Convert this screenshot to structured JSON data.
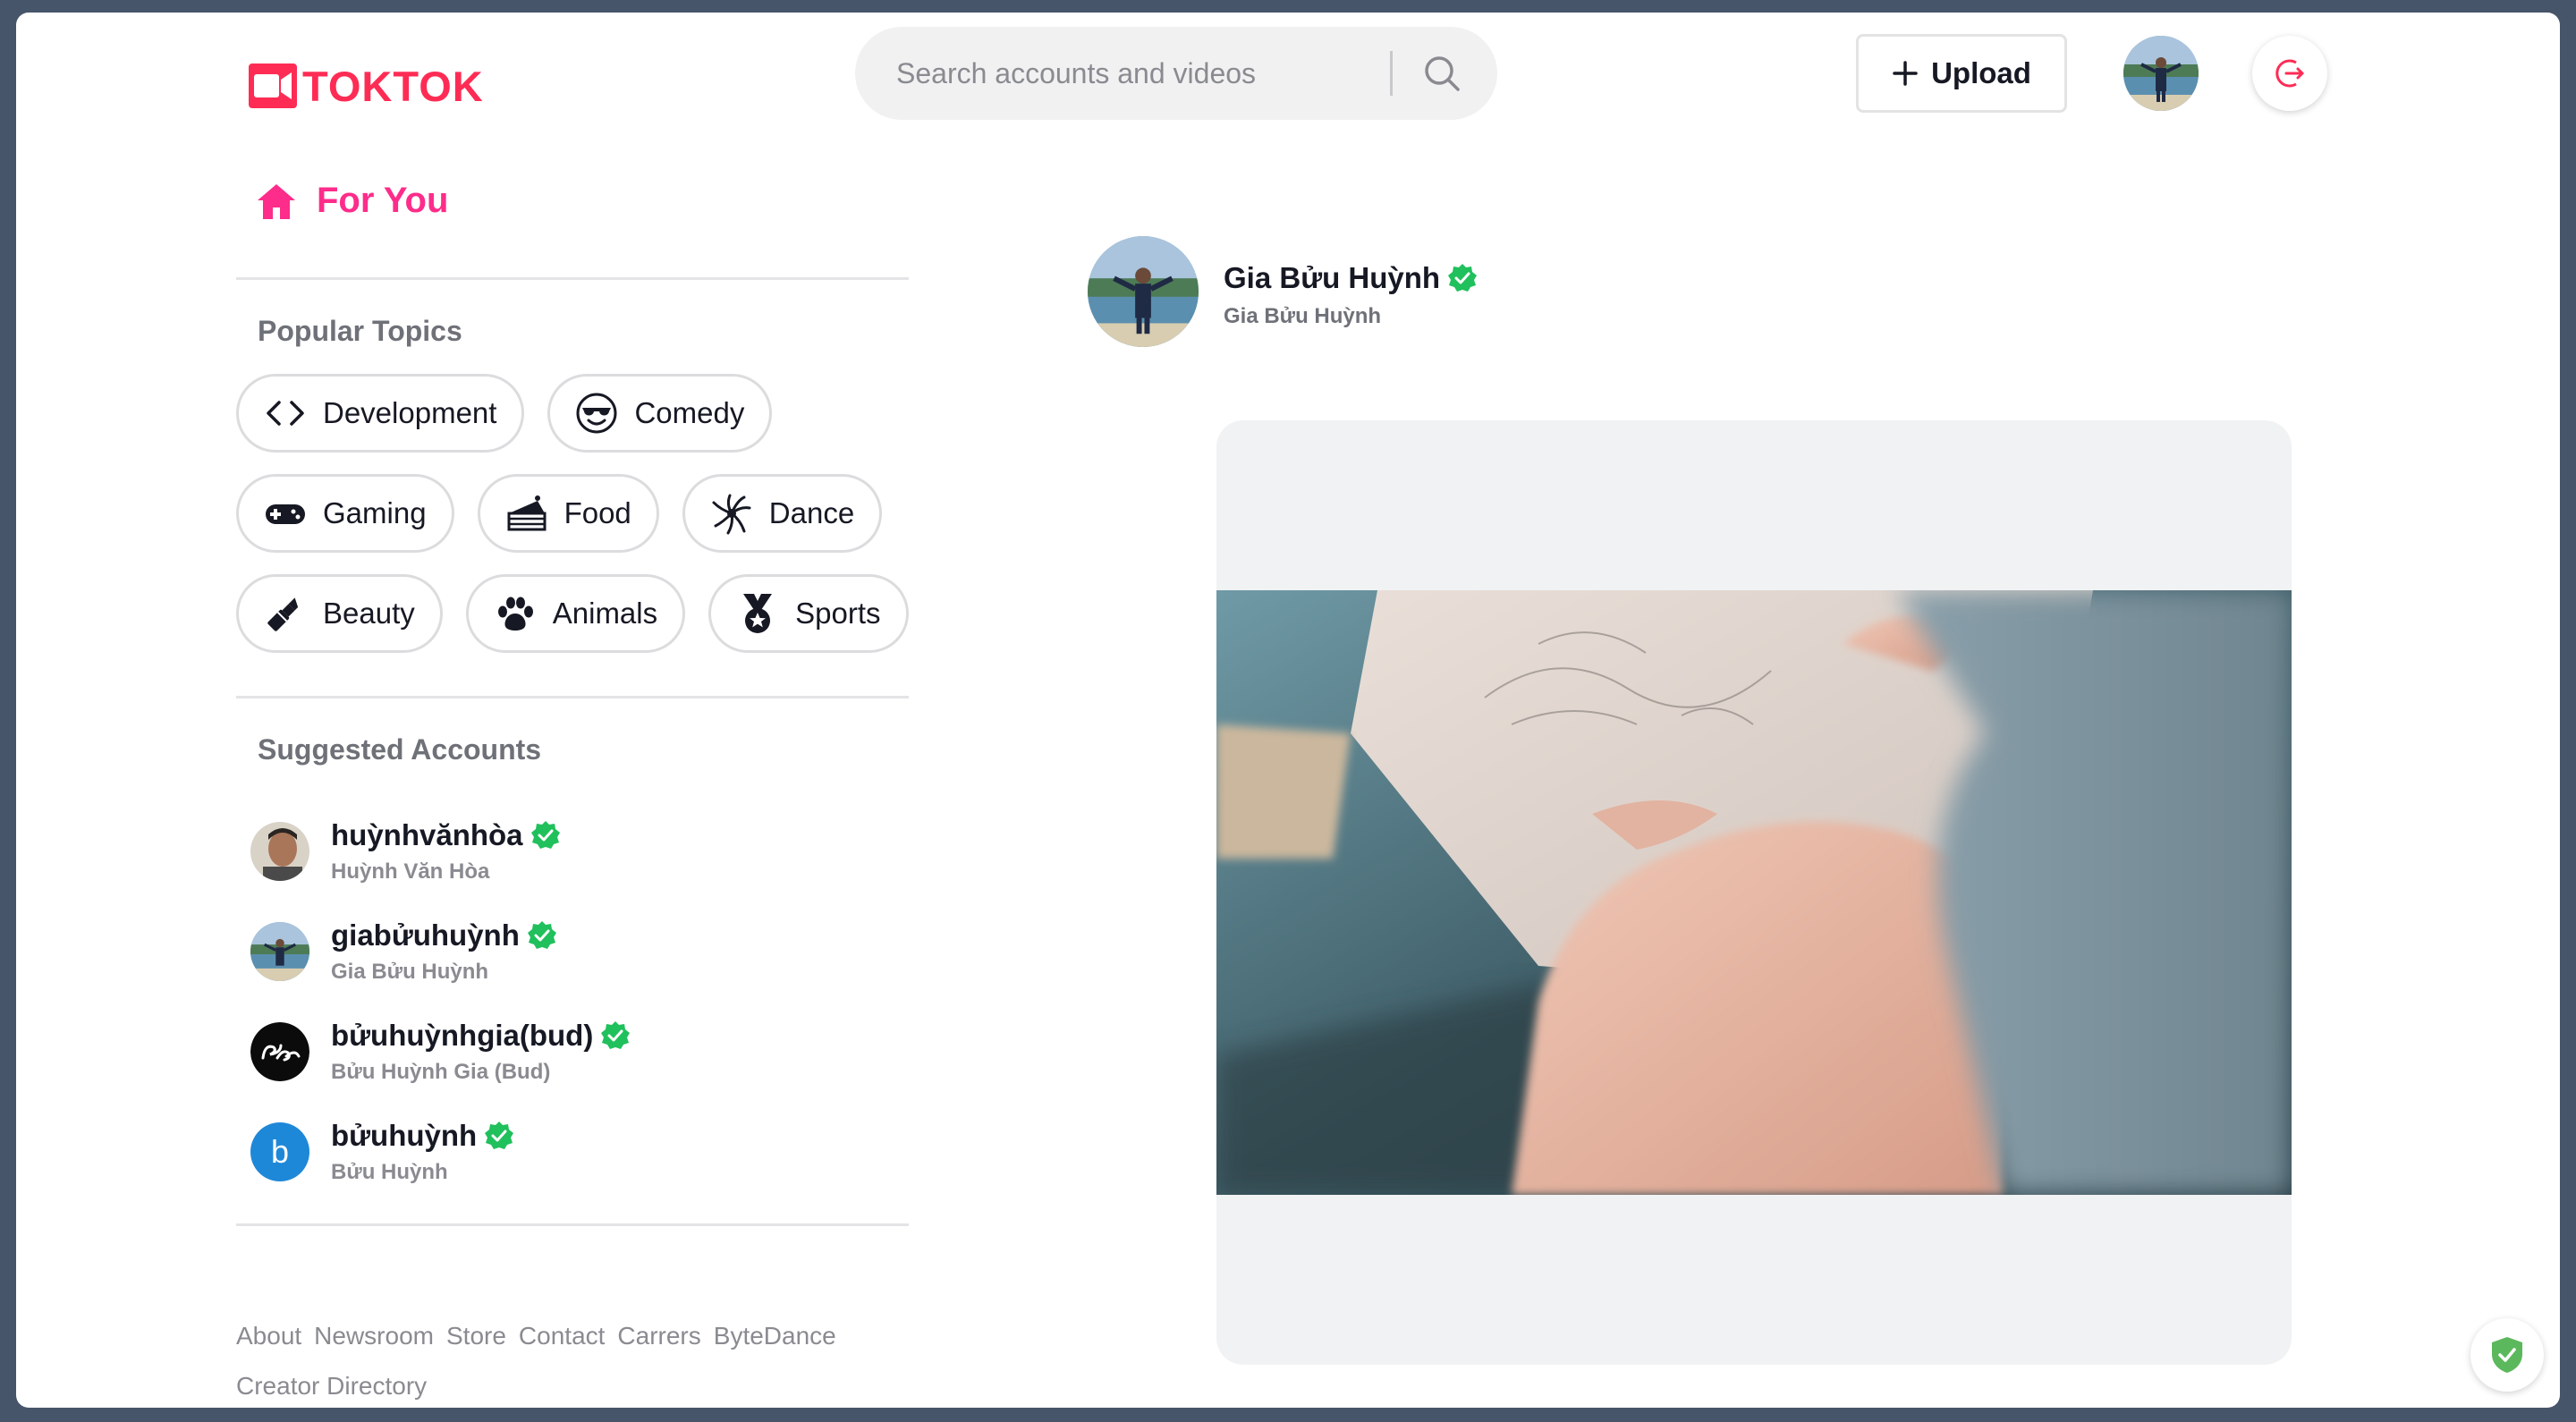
{
  "brand": {
    "name": "TOKTOK",
    "color": "#fe2c55"
  },
  "search": {
    "placeholder": "Search accounts and videos",
    "value": ""
  },
  "header": {
    "upload_label": "Upload"
  },
  "sidebar": {
    "for_you_label": "For You",
    "popular_topics_title": "Popular Topics",
    "topics": [
      {
        "label": "Development",
        "icon": "code-icon"
      },
      {
        "label": "Comedy",
        "icon": "sunglasses-face-icon"
      },
      {
        "label": "Gaming",
        "icon": "gamepad-icon"
      },
      {
        "label": "Food",
        "icon": "cake-icon"
      },
      {
        "label": "Dance",
        "icon": "dance-burst-icon"
      },
      {
        "label": "Beauty",
        "icon": "lipstick-icon"
      },
      {
        "label": "Animals",
        "icon": "paw-icon"
      },
      {
        "label": "Sports",
        "icon": "medal-icon"
      }
    ],
    "suggested_title": "Suggested Accounts",
    "accounts": [
      {
        "handle": "huỳnhvănhòa",
        "name": "Huỳnh Văn Hòa"
      },
      {
        "handle": "giabửuhuỳnh",
        "name": "Gia Bửu Huỳnh"
      },
      {
        "handle": "bửuhuỳnhgia(bud)",
        "name": "Bửu Huỳnh Gia (Bud)"
      },
      {
        "handle": "bửuhuỳnh",
        "name": "Bửu Huỳnh",
        "initial": "b"
      }
    ],
    "footer_links": [
      "About",
      "Newsroom",
      "Store",
      "Contact",
      "Carrers",
      "ByteDance",
      "Creator Directory"
    ]
  },
  "feed": {
    "post": {
      "handle": "Gia Bửu Huỳnh",
      "name": "Gia Bửu Huỳnh"
    }
  },
  "colors": {
    "accent_pink": "#fe2c8a",
    "verified_green": "#20d5a0",
    "avatar_blue": "#1e88d8"
  }
}
